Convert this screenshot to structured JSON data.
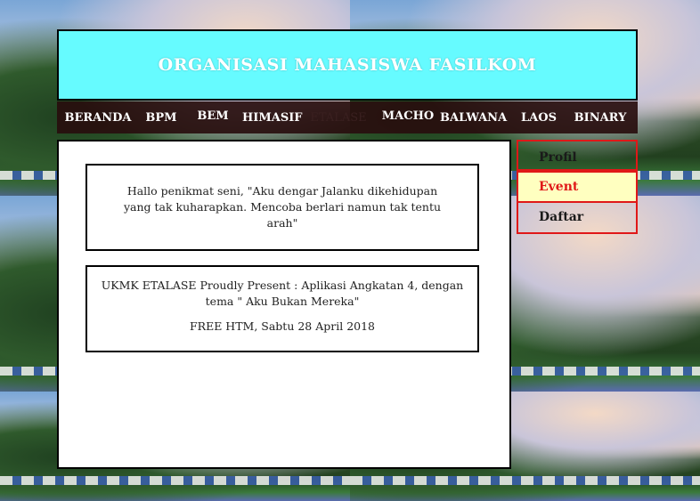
{
  "header": {
    "title": "ORGANISASI MAHASISWA FASILKOM"
  },
  "nav": {
    "items": [
      {
        "label": "BERANDA"
      },
      {
        "label": "BPM"
      },
      {
        "label": "BEM"
      },
      {
        "label": "HIMASIF"
      },
      {
        "label": "ETALASE"
      },
      {
        "label": "MACHO"
      },
      {
        "label": "BALWANA"
      },
      {
        "label": "LAOS"
      },
      {
        "label": "BINARY"
      }
    ],
    "active": "ETALASE"
  },
  "main": {
    "box1": {
      "text": "Hallo penikmat seni, \"Aku dengar Jalanku dikehidupan yang tak kuharapkan. Mencoba berlari namun tak tentu arah\""
    },
    "box2": {
      "line1": "UKMK ETALASE Proudly Present : Aplikasi Angkatan 4, dengan tema \" Aku Bukan Mereka\"",
      "line2": "FREE HTM, Sabtu 28 April 2018"
    }
  },
  "sidebar": {
    "items": [
      {
        "label": "Profil"
      },
      {
        "label": "Event"
      },
      {
        "label": "Daftar"
      }
    ],
    "active": "Event"
  },
  "colors": {
    "header_bg": "#66fbff",
    "nav_bg": "#2a0e0e",
    "sidebar_border": "#e01818",
    "sidebar_active_bg": "#ffffc0"
  }
}
